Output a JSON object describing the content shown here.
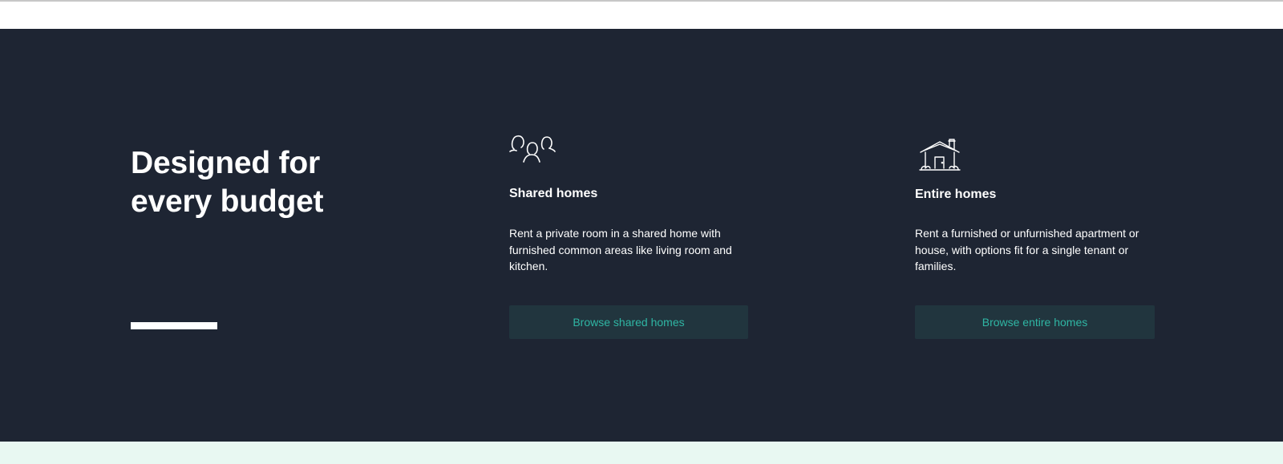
{
  "section": {
    "heading": "Designed for every budget"
  },
  "cards": [
    {
      "title": "Shared homes",
      "description": "Rent a private room in a shared home with furnished common areas like living room and kitchen.",
      "button_label": "Browse shared homes",
      "icon": "people-group-icon"
    },
    {
      "title": "Entire homes",
      "description": "Rent a furnished or unfurnished apartment or house, with options fit for a single tenant or families.",
      "button_label": "Browse entire homes",
      "icon": "house-icon"
    }
  ],
  "colors": {
    "section_background": "#1e2533",
    "button_background": "#21353e",
    "button_text": "#2fb6a4",
    "bottom_strip": "#e8f8f2",
    "text": "#ffffff"
  }
}
